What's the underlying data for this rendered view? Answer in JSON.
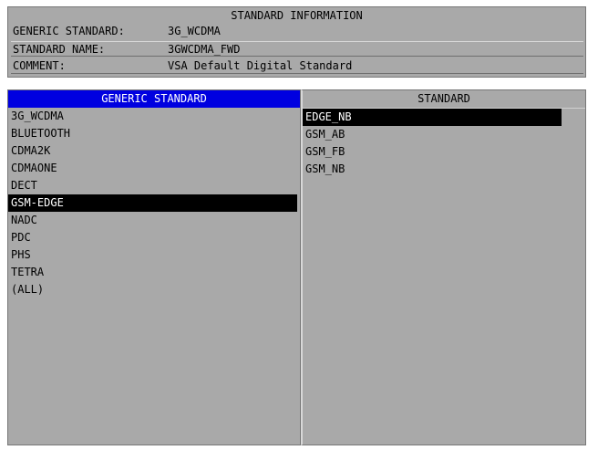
{
  "info": {
    "title": "STANDARD INFORMATION",
    "rows": [
      {
        "label": "GENERIC STANDARD:",
        "value": "3G_WCDMA"
      },
      {
        "label": "STANDARD NAME:",
        "value": "3GWCDMA_FWD"
      },
      {
        "label": "COMMENT:",
        "value": "VSA Default Digital Standard"
      }
    ]
  },
  "generic_standard": {
    "header": "GENERIC STANDARD",
    "items": [
      "3G_WCDMA",
      "BLUETOOTH",
      "CDMA2K",
      "CDMAONE",
      "DECT",
      "GSM-EDGE",
      "NADC",
      "PDC",
      "PHS",
      "TETRA",
      "(ALL)"
    ],
    "selected": "GSM-EDGE"
  },
  "standard": {
    "header": "STANDARD",
    "items": [
      "EDGE_NB",
      "GSM_AB",
      "GSM_FB",
      "GSM_NB"
    ],
    "selected": "EDGE_NB"
  },
  "colors": {
    "panel_bg": "#a9a9a9",
    "header_active": "#0000e0",
    "selection_bg": "#000000"
  }
}
